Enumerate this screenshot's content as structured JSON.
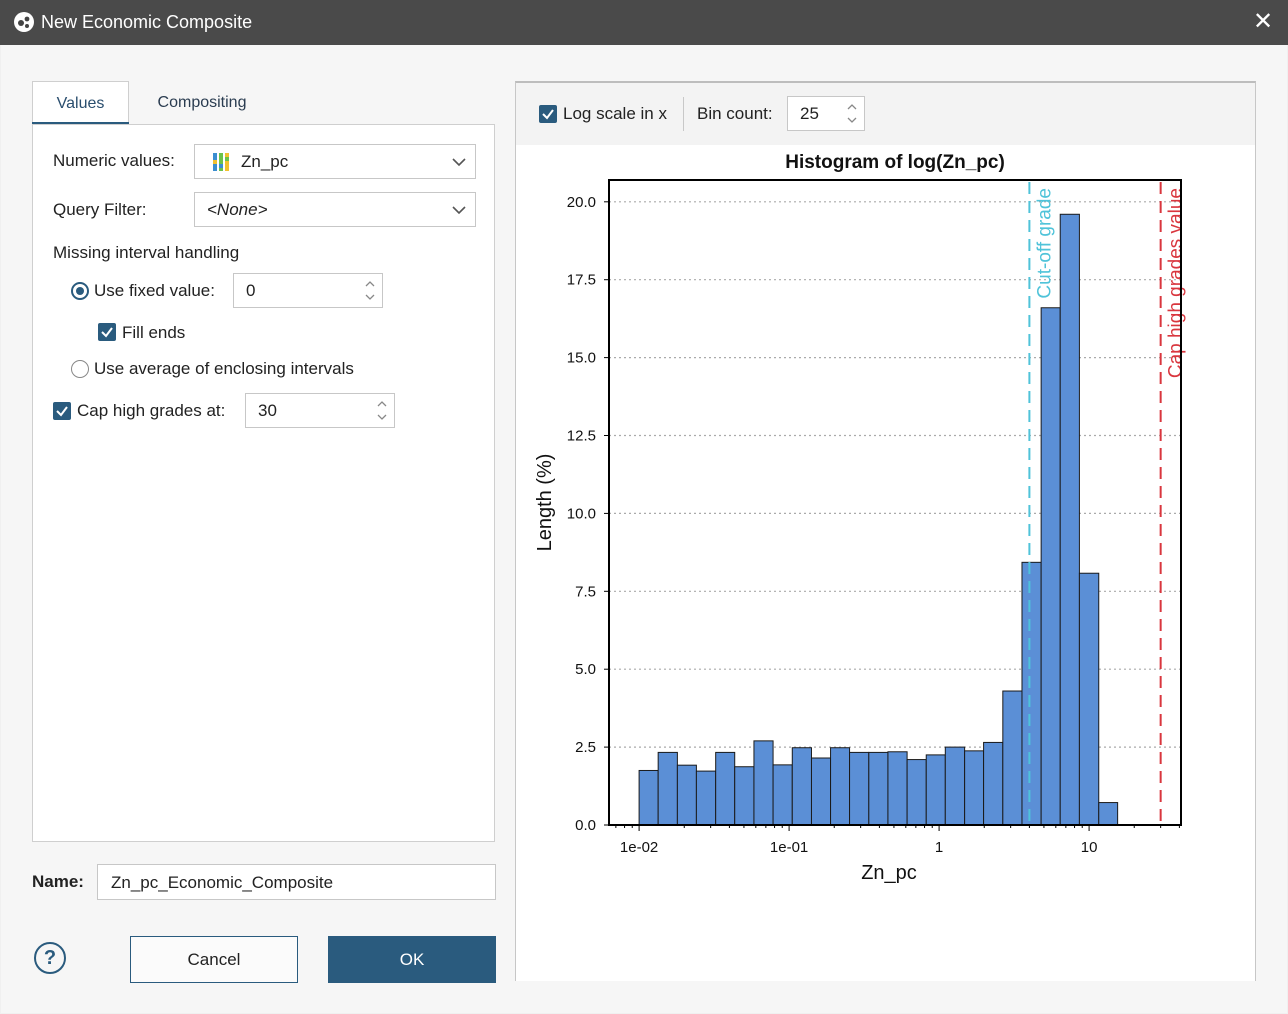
{
  "window": {
    "title": "New Economic Composite",
    "close_icon": "close-icon"
  },
  "tabs": [
    {
      "label": "Values",
      "active": true
    },
    {
      "label": "Compositing",
      "active": false
    }
  ],
  "values_tab": {
    "numeric_values_label": "Numeric values:",
    "numeric_values_selected": "Zn_pc",
    "query_filter_label": "Query Filter:",
    "query_filter_selected": "<None>",
    "missing_interval_heading": "Missing interval handling",
    "use_fixed_value_label": "Use fixed value:",
    "use_fixed_value_checked": true,
    "fixed_value": "0",
    "fill_ends_label": "Fill ends",
    "fill_ends_checked": true,
    "use_average_label": "Use average of enclosing intervals",
    "use_average_checked": false,
    "cap_high_grades_label": "Cap high grades at:",
    "cap_high_grades_checked": true,
    "cap_value": "30"
  },
  "name": {
    "label": "Name:",
    "value": "Zn_pc_Economic_Composite"
  },
  "buttons": {
    "help": "?",
    "cancel": "Cancel",
    "ok": "OK"
  },
  "plot_toolbar": {
    "log_scale_label": "Log scale in x",
    "log_scale_checked": true,
    "bin_count_label": "Bin count:",
    "bin_count_value": "25"
  },
  "colors": {
    "accent": "#2a5b7e",
    "bars": "#5b8fd6",
    "cutoff_line": "#4fc3d9",
    "cap_line": "#d9363e"
  },
  "chart_data": {
    "type": "bar",
    "title": "Histogram of log(Zn_pc)",
    "xlabel": "Zn_pc",
    "ylabel": "Length (%)",
    "x_scale": "log",
    "xlim": [
      0.0063,
      41
    ],
    "ylim": [
      0,
      20.7
    ],
    "xticks": [
      {
        "value": 0.01,
        "label": "1e-02"
      },
      {
        "value": 0.1,
        "label": "1e-01"
      },
      {
        "value": 1,
        "label": "1"
      },
      {
        "value": 10,
        "label": "10"
      }
    ],
    "yticks": [
      "0.0",
      "2.5",
      "5.0",
      "7.5",
      "10.0",
      "12.5",
      "15.0",
      "17.5",
      "20.0"
    ],
    "grid": "horizontal dotted",
    "bin_edges": [
      0.01,
      0.0134,
      0.018,
      0.0241,
      0.0324,
      0.0434,
      0.0583,
      0.0782,
      0.105,
      0.141,
      0.189,
      0.253,
      0.34,
      0.456,
      0.612,
      0.821,
      1.1,
      1.48,
      1.98,
      2.66,
      3.57,
      4.79,
      6.42,
      8.62,
      11.6,
      15.5,
      20.8,
      30
    ],
    "values": [
      1.75,
      2.33,
      1.92,
      1.73,
      2.33,
      1.87,
      2.7,
      1.93,
      2.48,
      2.15,
      2.48,
      2.33,
      2.33,
      2.35,
      2.1,
      2.25,
      2.5,
      2.38,
      2.65,
      4.3,
      8.43,
      16.6,
      19.6,
      8.08,
      0.72
    ],
    "annotations": [
      {
        "label": "Cut-off grade",
        "x": 4.0,
        "style": "dashed"
      },
      {
        "label": "Cap high grades value",
        "x": 30,
        "style": "dashed"
      }
    ]
  }
}
